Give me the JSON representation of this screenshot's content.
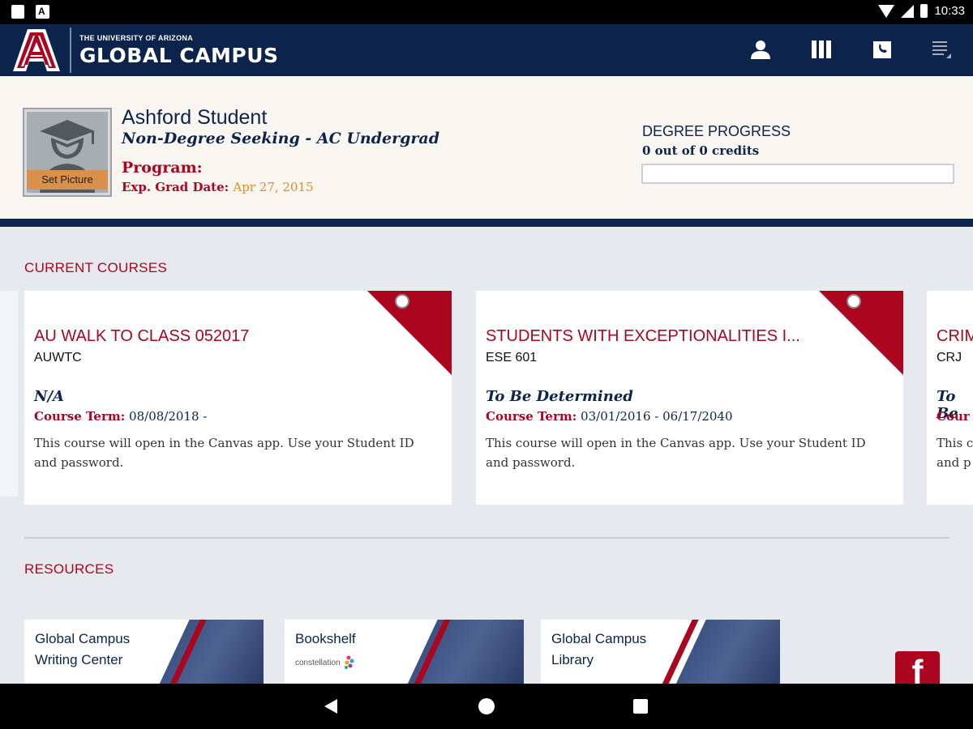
{
  "status_bar": {
    "time": "10:33"
  },
  "header": {
    "logo_small": "THE UNIVERSITY OF ARIZONA",
    "logo_big": "GLOBAL CAMPUS",
    "logo_letter": "A",
    "icons": [
      "profile-icon",
      "library-icon",
      "contact-icon",
      "menu-icon"
    ]
  },
  "profile": {
    "name": "Ashford Student",
    "subtitle": "Non-Degree Seeking - AC Undergrad",
    "program_label": "Program:",
    "grad_label": "Exp. Grad Date:",
    "grad_date": "Apr 27, 2015",
    "set_picture": "Set Picture",
    "degree_progress_title": "DEGREE PROGRESS",
    "credits_text": "0 out of 0 credits",
    "progress_fraction": 0
  },
  "current_courses": {
    "title": "CURRENT COURSES",
    "term_label": "Course Term:",
    "cards": [
      {
        "title": "AU WALK TO CLASS 052017",
        "code": "AUWTC",
        "instructor": "N/A",
        "term": "08/08/2018 -",
        "description": "This course will open in the Canvas app. Use your Student ID and password."
      },
      {
        "title": "STUDENTS WITH EXCEPTIONALITIES I...",
        "code": "ESE 601",
        "instructor": "To Be Determined",
        "term": "03/01/2016 - 06/17/2040",
        "description": "This course will open in the Canvas app. Use your Student ID and password."
      },
      {
        "title": "CRIM",
        "code": "CRJ",
        "instructor": "To Be",
        "term_label_partial": "Cour",
        "description": "This c\nand p"
      }
    ]
  },
  "resources": {
    "title": "RESOURCES",
    "tiles": [
      {
        "label": "Global Campus\nWriting Center"
      },
      {
        "label": "Bookshelf",
        "sublogo": "constellation"
      },
      {
        "label": "Global Campus\nLibrary"
      }
    ],
    "facebook_icon": "facebook-icon"
  },
  "colors": {
    "navy": "#0c234b",
    "red": "#ab0520",
    "orange": "#f08a24",
    "avatar_button": "#d9904a"
  }
}
